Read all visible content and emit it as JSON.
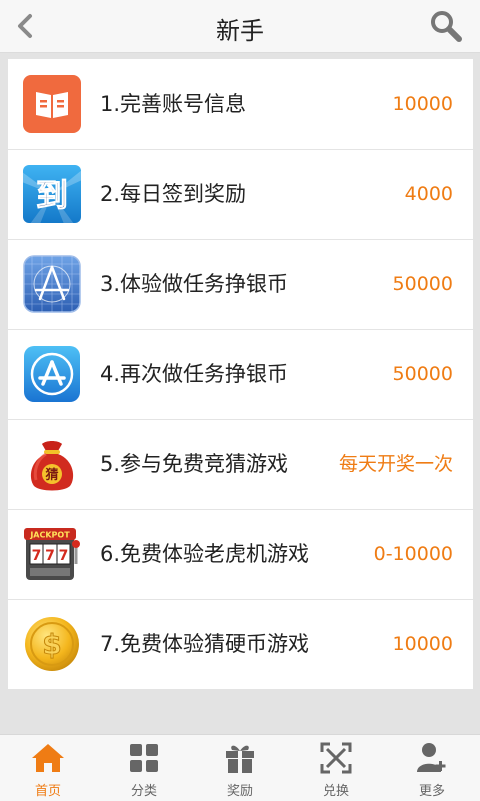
{
  "header": {
    "title": "新手"
  },
  "tasks": [
    {
      "label": "1.完善账号信息",
      "reward": "10000",
      "icon": "book-icon"
    },
    {
      "label": "2.每日签到奖励",
      "reward": "4000",
      "icon": "checkin-icon"
    },
    {
      "label": "3.体验做任务挣银币",
      "reward": "50000",
      "icon": "app-store-blueprint-icon"
    },
    {
      "label": "4.再次做任务挣银币",
      "reward": "50000",
      "icon": "app-store-icon"
    },
    {
      "label": "5.参与免费竞猜游戏",
      "reward": "每天开奖一次",
      "icon": "money-bag-icon",
      "icon_text": "猜"
    },
    {
      "label": "6.免费体验老虎机游戏",
      "reward": "0-10000",
      "icon": "slot-machine-icon",
      "icon_text": "JACKPOT"
    },
    {
      "label": "7.免费体验猜硬币游戏",
      "reward": "10000",
      "icon": "gold-coin-icon"
    }
  ],
  "icon_texts": {
    "checkin": "到"
  },
  "tabbar": {
    "items": [
      {
        "label": "首页",
        "icon": "home-icon",
        "active": true
      },
      {
        "label": "分类",
        "icon": "grid-icon",
        "active": false
      },
      {
        "label": "奖励",
        "icon": "gift-icon",
        "active": false
      },
      {
        "label": "兑换",
        "icon": "exchange-icon",
        "active": false
      },
      {
        "label": "更多",
        "icon": "user-plus-icon",
        "active": false
      }
    ]
  },
  "colors": {
    "accent": "#ef7c14",
    "background": "#e3e3e3"
  }
}
